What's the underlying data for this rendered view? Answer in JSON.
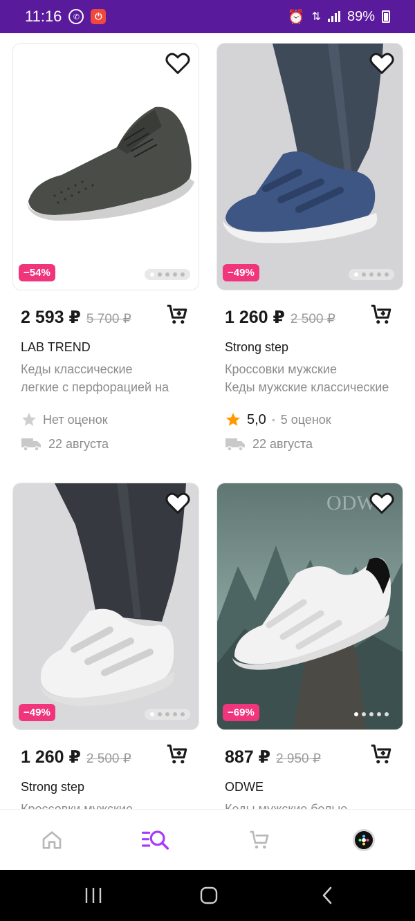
{
  "status_bar": {
    "time": "11:16",
    "battery": "89%"
  },
  "products": [
    {
      "price": "2 593 ₽",
      "old_price": "5 700 ₽",
      "discount": "−54%",
      "brand": "LAB TREND",
      "title_line1": "Кеды классические",
      "title_line2": "легкие с перфорацией на",
      "rating_text": "Нет оценок",
      "delivery": "22 августа",
      "image": "dark-grey-perforated-sneaker"
    },
    {
      "price": "1 260 ₽",
      "old_price": "2 500 ₽",
      "discount": "−49%",
      "brand": "Strong step",
      "title_line1": "Кроссовки мужские",
      "title_line2": "Кеды мужские классические",
      "rating_value": "5,0",
      "rating_count": "5 оценок",
      "delivery": "22 августа",
      "image": "navy-velcro-sneaker"
    },
    {
      "price": "1 260 ₽",
      "old_price": "2 500 ₽",
      "discount": "−49%",
      "brand": "Strong step",
      "title_line1": "Кроссовки мужские",
      "image": "white-velcro-sneaker"
    },
    {
      "price": "887 ₽",
      "old_price": "2 950 ₽",
      "discount": "−69%",
      "brand": "ODWE",
      "title_line1": "Кеды мужские белые",
      "image": "white-sneaker-on-rock"
    }
  ],
  "bottom_nav": {
    "items": [
      "home-icon",
      "catalog-search-icon",
      "cart-icon",
      "profile-avatar"
    ],
    "active": "catalog-search-icon"
  },
  "colors": {
    "status_bar": "#5a1a9c",
    "accent": "#a73afd",
    "discount": "#f0357c",
    "star": "#ff9b00"
  }
}
